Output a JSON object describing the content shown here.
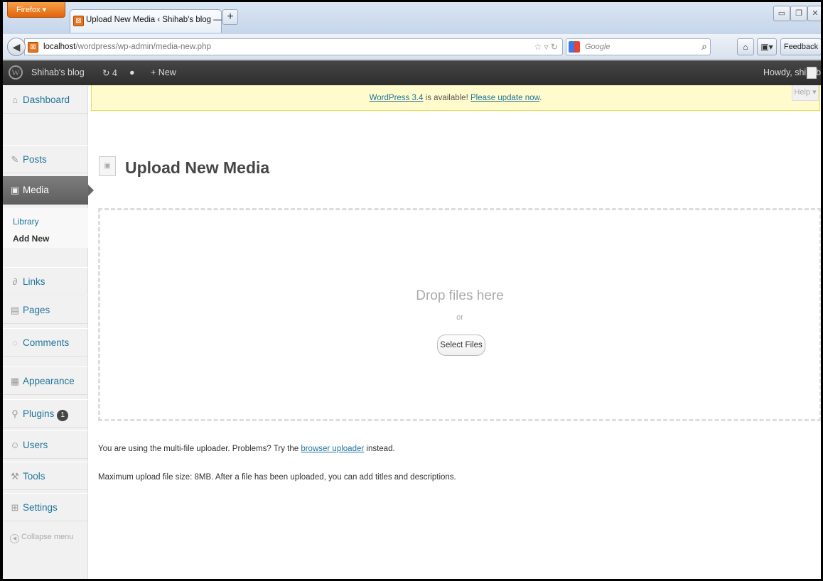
{
  "browser": {
    "app_button": "Firefox",
    "tab_title": "Upload New Media ‹ Shihab's blog — W...",
    "new_tab": "+",
    "url_host": "localhost",
    "url_path": "/wordpress/wp-admin/media-new.php",
    "search_placeholder": "Google",
    "feedback_label": "Feedback"
  },
  "adminbar": {
    "site_name": "Shihab's blog",
    "updates_count": "4",
    "new_label": "New",
    "howdy": "Howdy, shihab"
  },
  "sidebar": {
    "dashboard": "Dashboard",
    "posts": "Posts",
    "media": "Media",
    "library": "Library",
    "add_new": "Add New",
    "links": "Links",
    "pages": "Pages",
    "comments": "Comments",
    "appearance": "Appearance",
    "plugins": "Plugins",
    "plugins_badge": "1",
    "users": "Users",
    "tools": "Tools",
    "settings": "Settings",
    "collapse": "Collapse menu"
  },
  "notice": {
    "version_link": "WordPress 3.4",
    "middle": " is available! ",
    "update_link": "Please update now",
    "end": "."
  },
  "help_label": "Help",
  "page_title": "Upload New Media",
  "dropzone": {
    "drop_text": "Drop files here",
    "or_text": "or",
    "select_button": "Select Files"
  },
  "info": {
    "uploader_prefix": "You are using the multi-file uploader. Problems? Try the ",
    "browser_uploader_link": "browser uploader",
    "uploader_suffix": " instead.",
    "max_size": "Maximum upload file size: 8MB. After a file has been uploaded, you can add titles and descriptions."
  },
  "colors": {
    "link": "#21759b",
    "adminbar": "#464646",
    "notice_bg": "#fffbcc",
    "firefox_orange": "#e8731d"
  }
}
